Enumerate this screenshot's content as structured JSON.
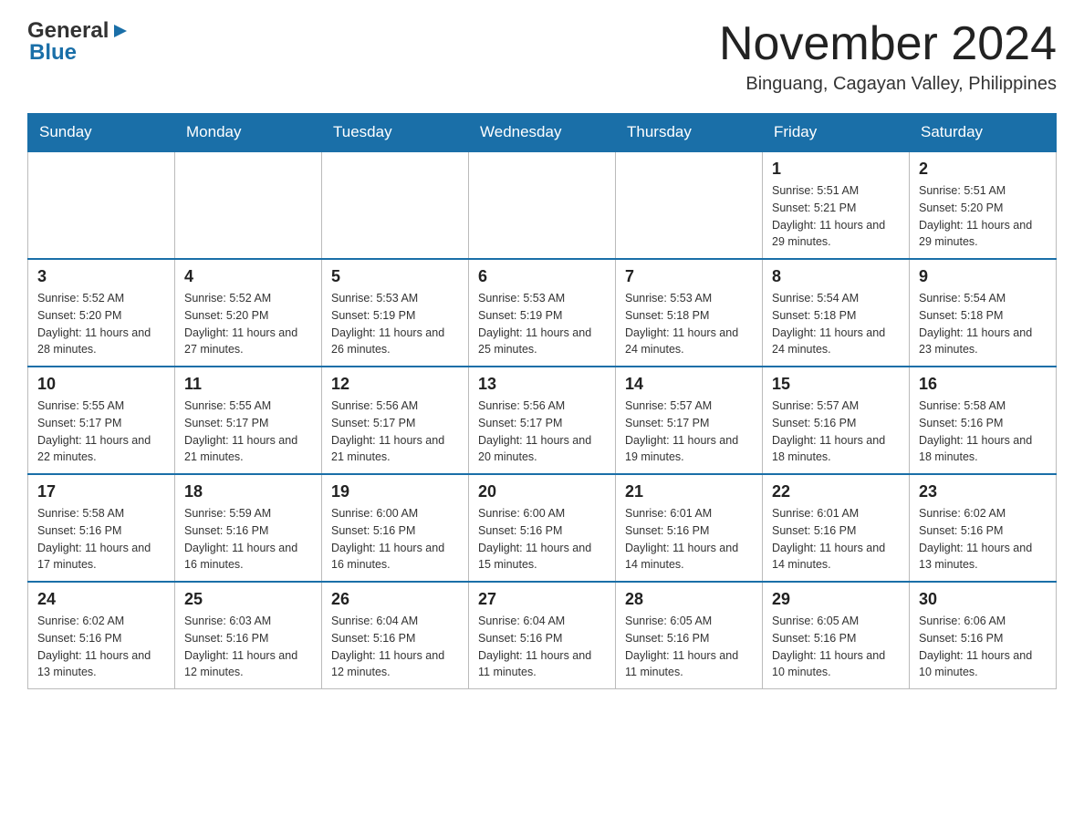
{
  "header": {
    "logo_general": "General",
    "logo_blue": "Blue",
    "month_title": "November 2024",
    "location": "Binguang, Cagayan Valley, Philippines"
  },
  "weekdays": [
    "Sunday",
    "Monday",
    "Tuesday",
    "Wednesday",
    "Thursday",
    "Friday",
    "Saturday"
  ],
  "weeks": [
    {
      "days": [
        {
          "number": "",
          "info": ""
        },
        {
          "number": "",
          "info": ""
        },
        {
          "number": "",
          "info": ""
        },
        {
          "number": "",
          "info": ""
        },
        {
          "number": "",
          "info": ""
        },
        {
          "number": "1",
          "info": "Sunrise: 5:51 AM\nSunset: 5:21 PM\nDaylight: 11 hours and 29 minutes."
        },
        {
          "number": "2",
          "info": "Sunrise: 5:51 AM\nSunset: 5:20 PM\nDaylight: 11 hours and 29 minutes."
        }
      ]
    },
    {
      "days": [
        {
          "number": "3",
          "info": "Sunrise: 5:52 AM\nSunset: 5:20 PM\nDaylight: 11 hours and 28 minutes."
        },
        {
          "number": "4",
          "info": "Sunrise: 5:52 AM\nSunset: 5:20 PM\nDaylight: 11 hours and 27 minutes."
        },
        {
          "number": "5",
          "info": "Sunrise: 5:53 AM\nSunset: 5:19 PM\nDaylight: 11 hours and 26 minutes."
        },
        {
          "number": "6",
          "info": "Sunrise: 5:53 AM\nSunset: 5:19 PM\nDaylight: 11 hours and 25 minutes."
        },
        {
          "number": "7",
          "info": "Sunrise: 5:53 AM\nSunset: 5:18 PM\nDaylight: 11 hours and 24 minutes."
        },
        {
          "number": "8",
          "info": "Sunrise: 5:54 AM\nSunset: 5:18 PM\nDaylight: 11 hours and 24 minutes."
        },
        {
          "number": "9",
          "info": "Sunrise: 5:54 AM\nSunset: 5:18 PM\nDaylight: 11 hours and 23 minutes."
        }
      ]
    },
    {
      "days": [
        {
          "number": "10",
          "info": "Sunrise: 5:55 AM\nSunset: 5:17 PM\nDaylight: 11 hours and 22 minutes."
        },
        {
          "number": "11",
          "info": "Sunrise: 5:55 AM\nSunset: 5:17 PM\nDaylight: 11 hours and 21 minutes."
        },
        {
          "number": "12",
          "info": "Sunrise: 5:56 AM\nSunset: 5:17 PM\nDaylight: 11 hours and 21 minutes."
        },
        {
          "number": "13",
          "info": "Sunrise: 5:56 AM\nSunset: 5:17 PM\nDaylight: 11 hours and 20 minutes."
        },
        {
          "number": "14",
          "info": "Sunrise: 5:57 AM\nSunset: 5:17 PM\nDaylight: 11 hours and 19 minutes."
        },
        {
          "number": "15",
          "info": "Sunrise: 5:57 AM\nSunset: 5:16 PM\nDaylight: 11 hours and 18 minutes."
        },
        {
          "number": "16",
          "info": "Sunrise: 5:58 AM\nSunset: 5:16 PM\nDaylight: 11 hours and 18 minutes."
        }
      ]
    },
    {
      "days": [
        {
          "number": "17",
          "info": "Sunrise: 5:58 AM\nSunset: 5:16 PM\nDaylight: 11 hours and 17 minutes."
        },
        {
          "number": "18",
          "info": "Sunrise: 5:59 AM\nSunset: 5:16 PM\nDaylight: 11 hours and 16 minutes."
        },
        {
          "number": "19",
          "info": "Sunrise: 6:00 AM\nSunset: 5:16 PM\nDaylight: 11 hours and 16 minutes."
        },
        {
          "number": "20",
          "info": "Sunrise: 6:00 AM\nSunset: 5:16 PM\nDaylight: 11 hours and 15 minutes."
        },
        {
          "number": "21",
          "info": "Sunrise: 6:01 AM\nSunset: 5:16 PM\nDaylight: 11 hours and 14 minutes."
        },
        {
          "number": "22",
          "info": "Sunrise: 6:01 AM\nSunset: 5:16 PM\nDaylight: 11 hours and 14 minutes."
        },
        {
          "number": "23",
          "info": "Sunrise: 6:02 AM\nSunset: 5:16 PM\nDaylight: 11 hours and 13 minutes."
        }
      ]
    },
    {
      "days": [
        {
          "number": "24",
          "info": "Sunrise: 6:02 AM\nSunset: 5:16 PM\nDaylight: 11 hours and 13 minutes."
        },
        {
          "number": "25",
          "info": "Sunrise: 6:03 AM\nSunset: 5:16 PM\nDaylight: 11 hours and 12 minutes."
        },
        {
          "number": "26",
          "info": "Sunrise: 6:04 AM\nSunset: 5:16 PM\nDaylight: 11 hours and 12 minutes."
        },
        {
          "number": "27",
          "info": "Sunrise: 6:04 AM\nSunset: 5:16 PM\nDaylight: 11 hours and 11 minutes."
        },
        {
          "number": "28",
          "info": "Sunrise: 6:05 AM\nSunset: 5:16 PM\nDaylight: 11 hours and 11 minutes."
        },
        {
          "number": "29",
          "info": "Sunrise: 6:05 AM\nSunset: 5:16 PM\nDaylight: 11 hours and 10 minutes."
        },
        {
          "number": "30",
          "info": "Sunrise: 6:06 AM\nSunset: 5:16 PM\nDaylight: 11 hours and 10 minutes."
        }
      ]
    }
  ]
}
